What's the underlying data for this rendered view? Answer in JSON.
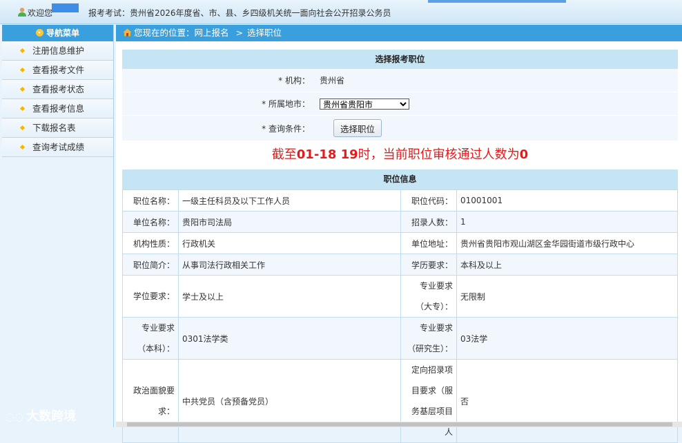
{
  "topbar": {
    "welcome": "欢迎您",
    "exam_title": "报考考试：贵州省2026年度省、市、县、乡四级机关统一面向社会公开招录公务员"
  },
  "sidebar": {
    "header": "导航菜单",
    "items": [
      {
        "label": "注册信息维护"
      },
      {
        "label": "查看报考文件"
      },
      {
        "label": "查看报考状态"
      },
      {
        "label": "查看报考信息"
      },
      {
        "label": "下载报名表"
      },
      {
        "label": "查询考试成绩"
      }
    ]
  },
  "watermark": "大数跨境",
  "breadcrumb": {
    "prefix": "您现在的位置：",
    "path1": "网上报名",
    "sep": ">",
    "path2": "选择职位"
  },
  "select_section": {
    "title": "选择报考职位",
    "org_label": "* 机构：",
    "org_value": "贵州省",
    "city_label": "* 所属地市：",
    "city_selected": "贵州省贵阳市",
    "query_label": "* 查询条件：",
    "select_button": "选择职位"
  },
  "notice": {
    "p1": "截至",
    "time": "01-18 19",
    "p2": "时，当前职位审核通过人数为",
    "count": "0"
  },
  "position_section": {
    "title": "职位信息",
    "rows": [
      {
        "k1": "职位名称：",
        "v1": "一级主任科员及以下工作人员",
        "k2": "职位代码：",
        "v2": "01001001"
      },
      {
        "k1": "单位名称：",
        "v1": "贵阳市司法局",
        "k2": "招录人数：",
        "v2": "1"
      },
      {
        "k1": "机构性质：",
        "v1": "行政机关",
        "k2": "单位地址：",
        "v2": "贵州省贵阳市观山湖区金华园街道市级行政中心"
      },
      {
        "k1": "职位简介：",
        "v1": "从事司法行政相关工作",
        "k2": "学历要求：",
        "v2": "本科及以上"
      },
      {
        "k1": "学位要求：",
        "v1": "学士及以上",
        "k2": "专业要求（大专）：",
        "v2": "无限制"
      },
      {
        "k1": "专业要求（本科）：",
        "v1": "0301法学类",
        "k2": "专业要求（研究生）：",
        "v2": "03法学"
      },
      {
        "k1": "政治面貌要求：",
        "v1": "中共党员（含预备党员）",
        "k2": "定向招录项目要求（服务基层项目人",
        "v2": "否"
      }
    ]
  },
  "colors": {
    "accent": "#3aa0dd",
    "notice_red": "#e31b1b",
    "section_head": "#c5e4f4"
  }
}
